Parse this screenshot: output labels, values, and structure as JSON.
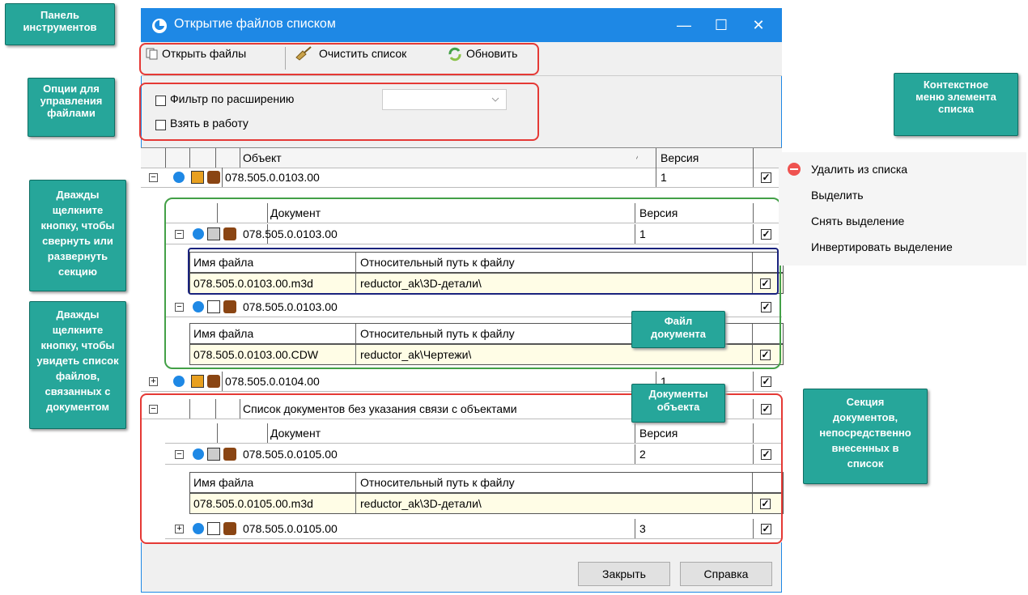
{
  "window": {
    "title": "Открытие файлов списком",
    "minimize": "—",
    "maximize": "☐",
    "close": "✕"
  },
  "toolbar": {
    "open_files": "Открыть файлы",
    "clear_list": "Очистить список",
    "refresh": "Обновить"
  },
  "options": {
    "filter_label": "Фильтр по расширению",
    "take_to_work_label": "Взять в работу"
  },
  "grid": {
    "header_object": "Объект",
    "header_version": "Версия",
    "sort_mark": "⁄",
    "doc_header": "Документ",
    "doc_version_header": "Версия",
    "file_name_header": "Имя файла",
    "rel_path_header": "Относительный путь к файлу",
    "obj1_name": "078.505.0.0103.00",
    "obj1_version": "1",
    "doc1_name": "078.505.0.0103.00",
    "doc1_version": "1",
    "file1_name": "078.505.0.0103.00.m3d",
    "file1_path": "reductor_ak\\3D-детали\\",
    "doc2_name": "078.505.0.0103.00",
    "file2_name": "078.505.0.0103.00.CDW",
    "file2_path": "reductor_ak\\Чертежи\\",
    "obj2_name": "078.505.0.0104.00",
    "obj2_version": "1",
    "section_label": "Список документов без указания связи с объектами",
    "doc3_name": "078.505.0.0105.00",
    "doc3_version": "2",
    "file3_name": "078.505.0.0105.00.m3d",
    "file3_path": "reductor_ak\\3D-детали\\",
    "doc4_name": "078.505.0.0105.00",
    "doc4_version": "3"
  },
  "buttons": {
    "close": "Закрыть",
    "help": "Справка"
  },
  "context_menu": {
    "remove": "Удалить из списка",
    "select": "Выделить",
    "deselect": "Снять выделение",
    "invert": "Инвертировать выделение"
  },
  "callouts": {
    "toolbar": [
      "Панель",
      "инструментов"
    ],
    "options": [
      "Опции для",
      "управления",
      "файлами"
    ],
    "context": [
      "Контекстное",
      "меню элемента",
      "списка"
    ],
    "expand": [
      "Дважды",
      "щелкните",
      "кнопку, чтобы",
      "свернуть или",
      "развернуть",
      "секцию"
    ],
    "files": [
      "Дважды",
      "щелкните",
      "кнопку, чтобы",
      "увидеть список",
      "файлов,",
      "связанных с",
      "документом"
    ],
    "doc_file": [
      "Файл",
      "документа"
    ],
    "obj_docs": [
      "Документы",
      "объекта"
    ],
    "section": [
      "Секция",
      "документов,",
      "непосредственно",
      "внесенных в",
      "список"
    ]
  },
  "colors": {
    "title_bar": "#1e88e5",
    "callout": "#26a69a",
    "red_frame": "#e53935",
    "green_frame": "#43a047",
    "blue_frame": "#1a237e",
    "file_row": "#fffde6"
  },
  "icons": {
    "app": "app-logo-icon",
    "open": "open-files-icon",
    "clear": "broom-icon",
    "refresh": "refresh-icon",
    "remove": "remove-icon"
  }
}
